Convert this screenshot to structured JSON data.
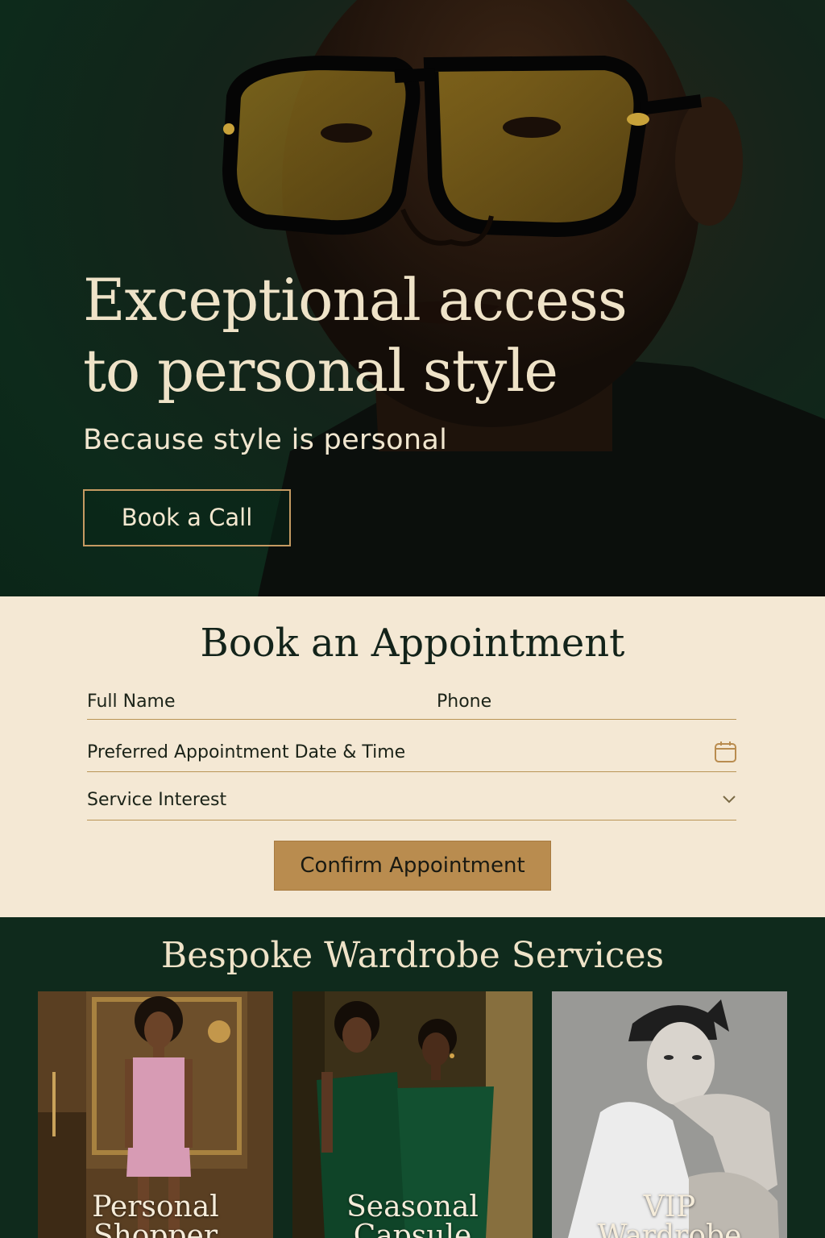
{
  "hero": {
    "title_line1": "Exceptional access",
    "title_line2": "to personal style",
    "subtitle": "Because style is personal",
    "cta_label": "Book a Call"
  },
  "booking": {
    "title": "Book an Appointment",
    "fields": {
      "full_name": "Full Name",
      "phone": "Phone",
      "datetime": "Preferred Appointment Date & Time",
      "service": "Service Interest"
    },
    "confirm_label": "Confirm Appointment"
  },
  "services": {
    "title": "Bespoke Wardrobe Services",
    "cards": [
      {
        "line1": "Personal",
        "line2": "Shopper"
      },
      {
        "line1": "Seasonal",
        "line2": "Capsule"
      },
      {
        "line1": "VIP",
        "line2": "Wardrobe"
      }
    ]
  },
  "colors": {
    "forest_green": "#0f2a1c",
    "cream": "#f4e8d4",
    "gold": "#b98c4f",
    "hero_text": "#efe3c8"
  },
  "icons": [
    "calendar-icon",
    "chevron-down-icon"
  ]
}
